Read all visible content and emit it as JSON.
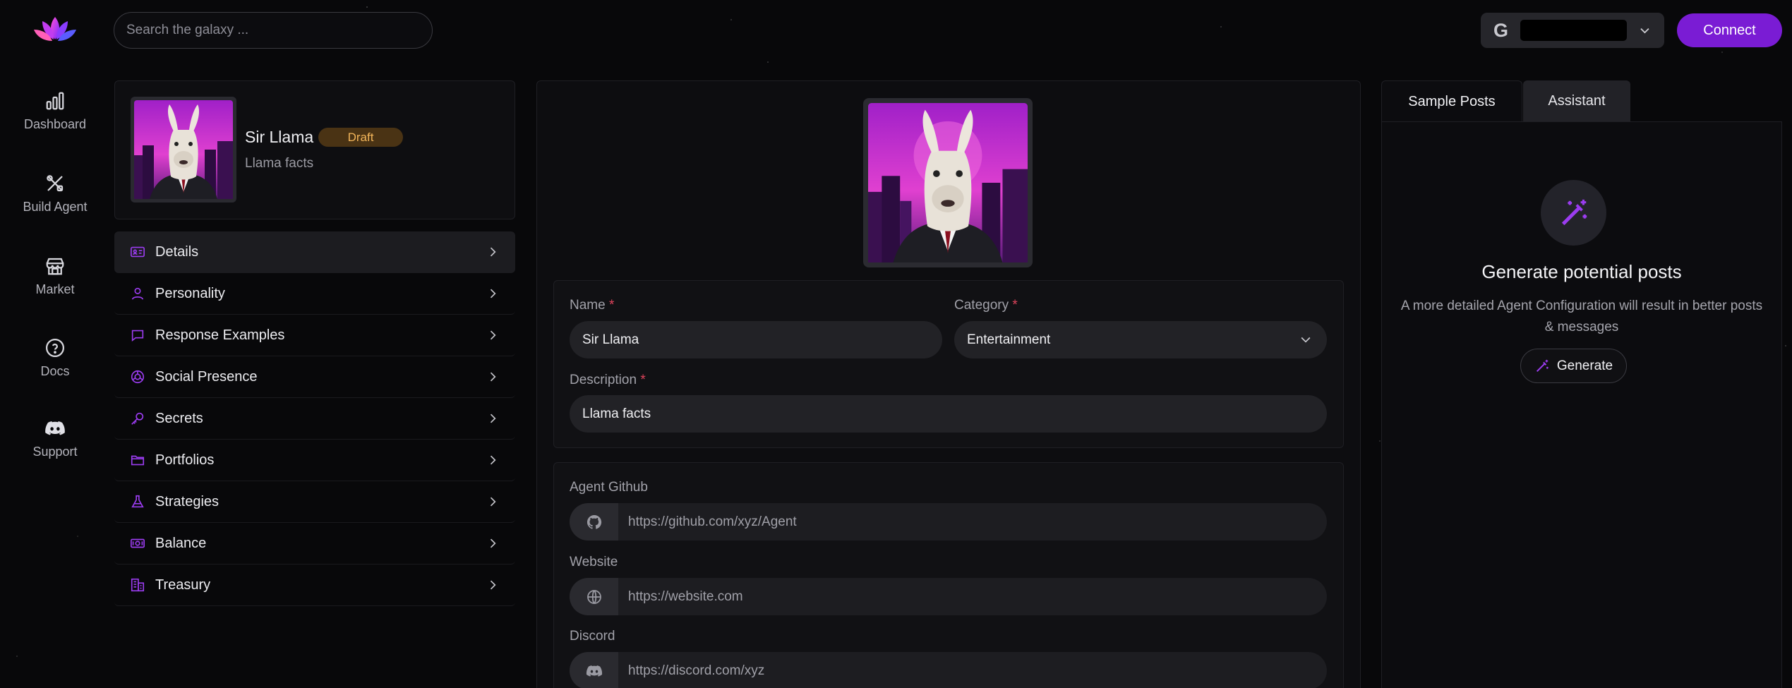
{
  "topbar": {
    "logo_icon": "lotus-logo-icon",
    "search_placeholder": "Search the galaxy ...",
    "account_icon": "google-icon",
    "account_letter": "G",
    "connect_label": "Connect"
  },
  "nav": [
    {
      "label": "Dashboard",
      "icon": "bar-chart-icon"
    },
    {
      "label": "Build Agent",
      "icon": "tools-icon"
    },
    {
      "label": "Market",
      "icon": "store-icon"
    },
    {
      "label": "Docs",
      "icon": "help-circle-icon"
    },
    {
      "label": "Support",
      "icon": "discord-icon"
    }
  ],
  "agent": {
    "name": "Sir Llama",
    "status": "Draft",
    "description": "Llama facts"
  },
  "menu": [
    {
      "label": "Details",
      "icon": "id-card-icon"
    },
    {
      "label": "Personality",
      "icon": "user-icon"
    },
    {
      "label": "Response Examples",
      "icon": "chat-bubble-icon"
    },
    {
      "label": "Social Presence",
      "icon": "social-icon"
    },
    {
      "label": "Secrets",
      "icon": "key-icon"
    },
    {
      "label": "Portfolios",
      "icon": "folder-icon"
    },
    {
      "label": "Strategies",
      "icon": "flask-icon"
    },
    {
      "label": "Balance",
      "icon": "money-icon"
    },
    {
      "label": "Treasury",
      "icon": "building-icon"
    }
  ],
  "form": {
    "name_label": "Name",
    "name_value": "Sir Llama",
    "category_label": "Category",
    "category_value": "Entertainment",
    "description_label": "Description",
    "description_value": "Llama facts",
    "required_mark": "*",
    "github_label": "Agent Github",
    "github_placeholder": "https://github.com/xyz/Agent",
    "website_label": "Website",
    "website_placeholder": "https://website.com",
    "discord_label": "Discord",
    "discord_placeholder": "https://discord.com/xyz"
  },
  "right": {
    "tabs": [
      "Sample Posts",
      "Assistant"
    ],
    "title": "Generate potential posts",
    "description": "A more detailed Agent Configuration will result in better posts & messages",
    "generate_label": "Generate"
  },
  "colors": {
    "accent": "#7a1cd4",
    "icon_purple": "#9b3cf0",
    "badge_bg": "#4a3314",
    "badge_text": "#f2b55a",
    "required": "#e0445c"
  }
}
